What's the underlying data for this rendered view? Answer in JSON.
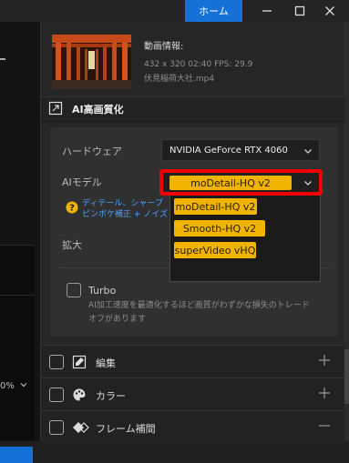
{
  "window": {
    "home_tab_label": "ホーム",
    "controls": [
      "minimize-icon",
      "maximize-icon",
      "close-icon"
    ]
  },
  "left_panel": {
    "zoom_text": "0%"
  },
  "video_info": {
    "title": "動画情報:",
    "meta": "432 x 320  02:40   FPS: 29.9",
    "filename": "伏見稲荷大社.mp4"
  },
  "ai_section": {
    "title": "AI高画質化",
    "hardware_label": "ハードウェア",
    "hardware_value": "NVIDIA GeForce RTX 4060",
    "model_label": "AIモデル",
    "model_selected": "moDetail-HQ  v2",
    "model_options": [
      "moDetail-HQ  v2",
      "Smooth-HQ  v2",
      "superVideo  vHQ"
    ],
    "help_line1": "ディテール、シャープ",
    "help_line2": "ピンボケ補正 + ノイズ",
    "upscale_label": "拡大",
    "turbo_label": "Turbo",
    "turbo_desc": "AI加工速度を最適化するほど画質がわずかな損失のトレードオフがあります"
  },
  "accordion": [
    {
      "label": "編集",
      "icon": "edit-icon",
      "toggle": "+"
    },
    {
      "label": "カラー",
      "icon": "palette-icon",
      "toggle": "+"
    },
    {
      "label": "フレーム補間",
      "icon": "frame-interpolation-icon",
      "toggle": "−"
    }
  ],
  "colors": {
    "accent_blue": "#1570d8",
    "pill_yellow": "#f0b400",
    "highlight_red": "#f20000",
    "panel": "#262626",
    "card": "#303030"
  }
}
